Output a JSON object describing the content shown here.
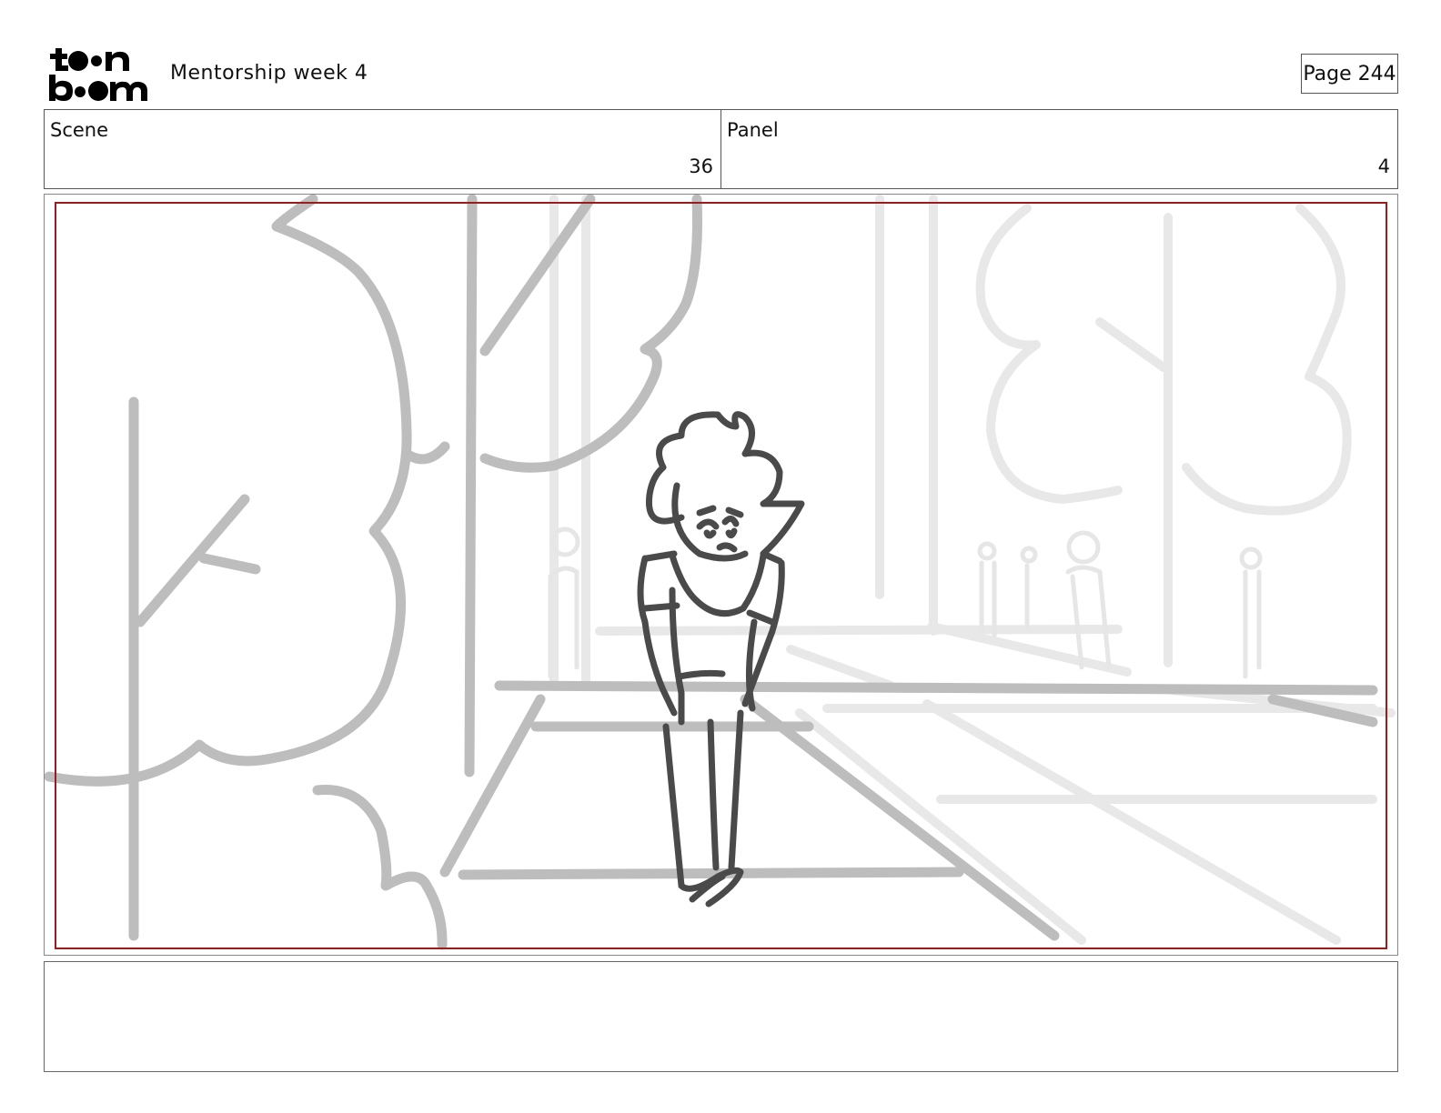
{
  "header": {
    "logo_text": "toon boom",
    "project_title": "Mentorship week 4",
    "page_label": "Page 244"
  },
  "info": {
    "scene_label": "Scene",
    "scene_value": "36",
    "panel_label": "Panel",
    "panel_value": "4"
  },
  "drawing": {
    "description_icon": "storyboard-sketch",
    "safe_area_color": "#9b1c1c"
  },
  "notes": {
    "text": ""
  }
}
